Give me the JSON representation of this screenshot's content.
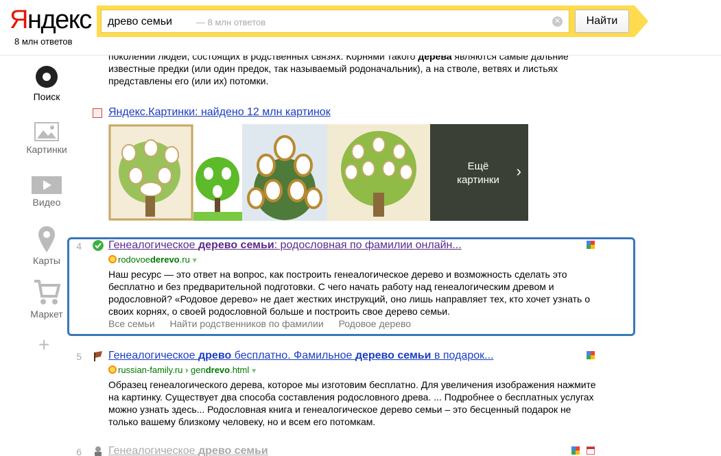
{
  "header": {
    "logo_first": "Я",
    "logo_rest": "ндекс",
    "logo_sub": "8 млн ответов",
    "search_query": "древо семьи",
    "search_hint": "— 8 млн ответов",
    "search_button": "Найти"
  },
  "nav": [
    {
      "label": "Поиск",
      "icon": "search-icon"
    },
    {
      "label": "Картинки",
      "icon": "image-icon"
    },
    {
      "label": "Видео",
      "icon": "video-icon"
    },
    {
      "label": "Карты",
      "icon": "map-pin-icon"
    },
    {
      "label": "Маркет",
      "icon": "cart-icon"
    }
  ],
  "snippet_top": {
    "line1": "поколений людей, состоящих в родственных связях. Корнями такого",
    "line1_bold": "дерева",
    "line1_end": "являются самые дальние",
    "line2": "известные предки (или один предок, так называемый родоначальник), а на стволе, ветвях и листьях",
    "line3": "представлены его (или их) потомки."
  },
  "images": {
    "title": "Яндекс.Картинки: найдено 12 млн картинок",
    "more": "Ещё картинки"
  },
  "results": [
    {
      "num": "4",
      "title_a": "Генеалогическое",
      "title_b": "дерево семьи",
      "title_c": ": родословная по фамилии онлайн...",
      "url_a": "rodovoe",
      "url_b": "derevo",
      "url_c": ".ru",
      "text": "Наш ресурс — это ответ на вопрос, как построить генеалогическое дерево и возможность сделать это бесплатно и без предварительной подготовки. С чего начать работу над генеалогическим древом и родословной? «Родовое дерево» не дает жестких инструкций, оно лишь направляет тех, кто хочет узнать о своих корнях, о своей родословной больше и построить свое дерево семьи.",
      "sitelinks": [
        "Все семьи",
        "Найти родственников по фамилии",
        "Родовое дерево"
      ]
    },
    {
      "num": "5",
      "title_a": "Генеалогическое",
      "title_b": "древо",
      "title_c": "бесплатно. Фамильное",
      "title_d": "дерево семьи",
      "title_e": "в подарок...",
      "url_a": "russian-family.ru",
      "url_sep": "›",
      "url_b": "gen",
      "url_c": "drevo",
      "url_d": ".html",
      "text": "Образец генеалогического дерева, которое мы изготовим бесплатно. Для увеличения изображения нажмите на картинку. Существует два способа составления родословного древа. ... Подробнее о бесплатных услугах можно узнать здесь... Родословная книга и генеалогическое дерево семьи – это бесценный подарок не только вашему близкому человеку, но и всем его потомкам."
    },
    {
      "num": "6",
      "title_a": "Генеалогическое",
      "title_b": "древо семьи"
    }
  ],
  "colors": {
    "accent": "#ffdb4d",
    "link": "#1a3dc1",
    "visited": "#5a2b8a",
    "url": "#007700",
    "highlight": "#3b76b8"
  }
}
